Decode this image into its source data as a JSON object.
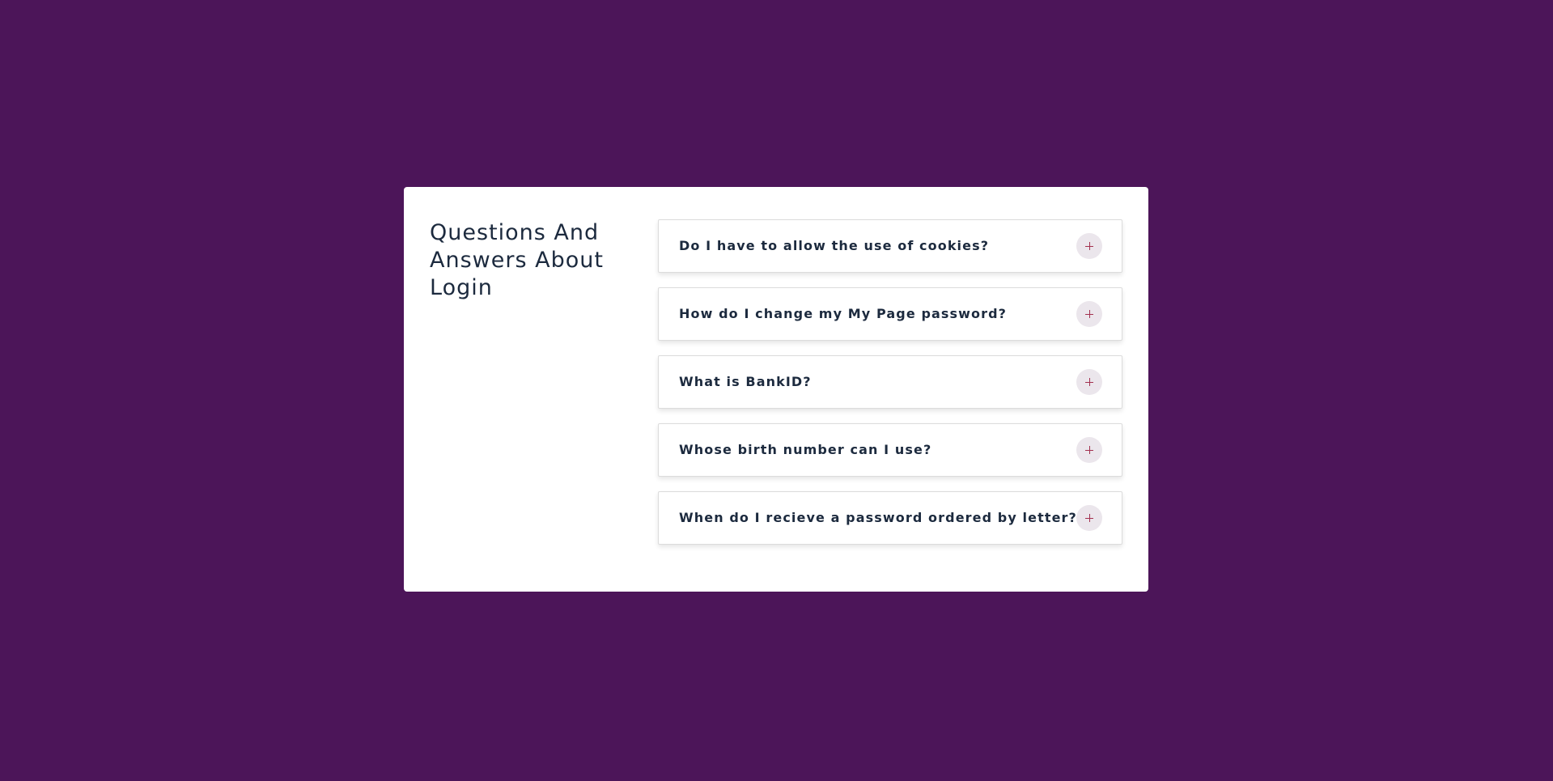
{
  "faq": {
    "title": "Questions And Answers About Login",
    "items": [
      {
        "question": "Do I have to allow the use of cookies?",
        "icon": "plus-icon"
      },
      {
        "question": "How do I change my My Page password?",
        "icon": "plus-icon"
      },
      {
        "question": "What is BankID?",
        "icon": "plus-icon"
      },
      {
        "question": "Whose birth number can I use?",
        "icon": "plus-icon"
      },
      {
        "question": "When do I recieve a password ordered by letter?",
        "icon": "plus-icon"
      }
    ]
  },
  "colors": {
    "background": "#4c1559",
    "card": "#ffffff",
    "text": "#1c2a3e",
    "toggle_bg": "#ebe6ec",
    "toggle_icon": "#a3304f"
  }
}
